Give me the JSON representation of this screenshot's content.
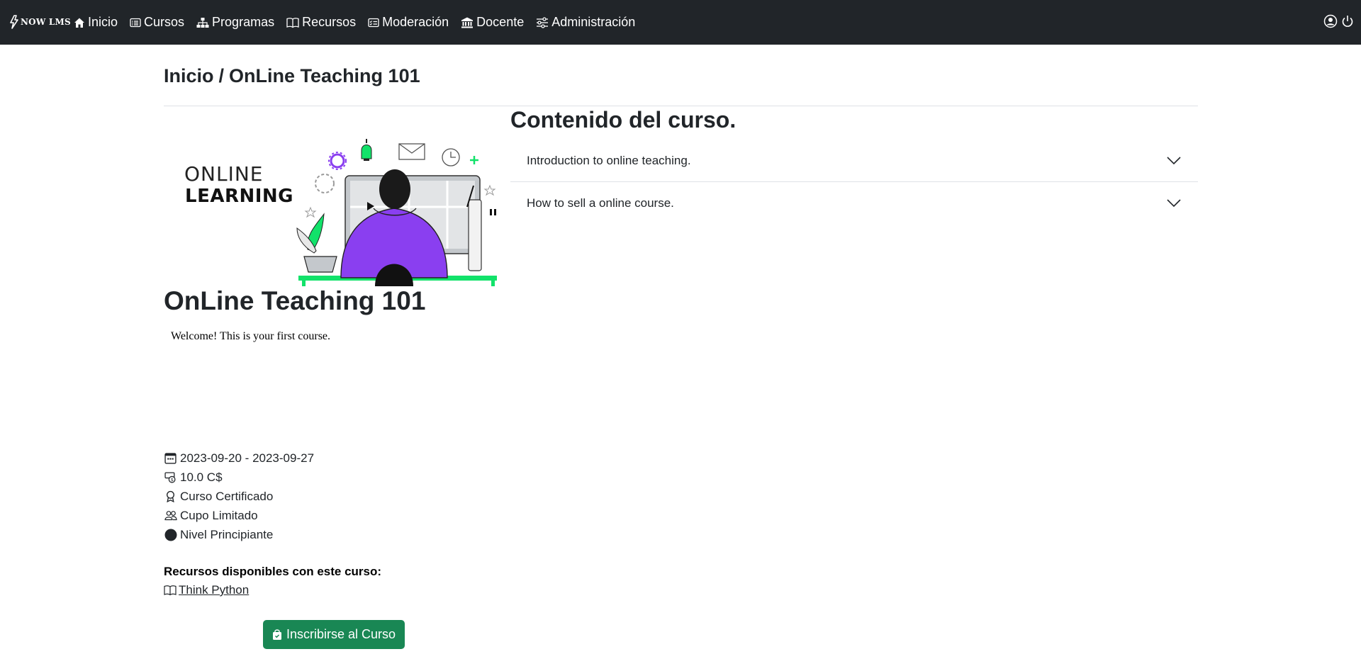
{
  "navbar": {
    "brand": "NOW LMS",
    "items": [
      {
        "label": "Inicio",
        "icon": "house-icon"
      },
      {
        "label": "Cursos",
        "icon": "card-list-icon"
      },
      {
        "label": "Programas",
        "icon": "diagram-icon"
      },
      {
        "label": "Recursos",
        "icon": "book-icon"
      },
      {
        "label": "Moderación",
        "icon": "card-checklist-icon"
      },
      {
        "label": "Docente",
        "icon": "bank-icon"
      },
      {
        "label": "Administración",
        "icon": "sliders-icon"
      }
    ],
    "right_icons": [
      "user-circle-icon",
      "power-icon"
    ]
  },
  "breadcrumb": {
    "home": "Inicio",
    "separator": "/",
    "current": "OnLine Teaching 101"
  },
  "course": {
    "image_text_line1": "ONLINE",
    "image_text_line2": "LEARNING",
    "title": "OnLine Teaching 101",
    "description": "Welcome! This is your first course.",
    "dates": "2023-09-20 - 2023-09-27",
    "price": "10.0 C$",
    "certified": "Curso Certificado",
    "capacity": "Cupo Limitado",
    "level": "Nivel Principiante"
  },
  "resources": {
    "title": "Recursos disponibles con este curso:",
    "items": [
      {
        "label": " Think Python",
        "icon": "book-icon"
      }
    ]
  },
  "enroll_button": "Inscribirse al Curso",
  "content": {
    "title": "Contenido del curso.",
    "sections": [
      {
        "label": "Introduction to online teaching."
      },
      {
        "label": "How to sell a online course."
      }
    ]
  },
  "colors": {
    "navbar_bg": "#212529",
    "enroll_button": "#198754",
    "illustration_purple": "#8a3ff0",
    "illustration_green": "#12e26a"
  }
}
